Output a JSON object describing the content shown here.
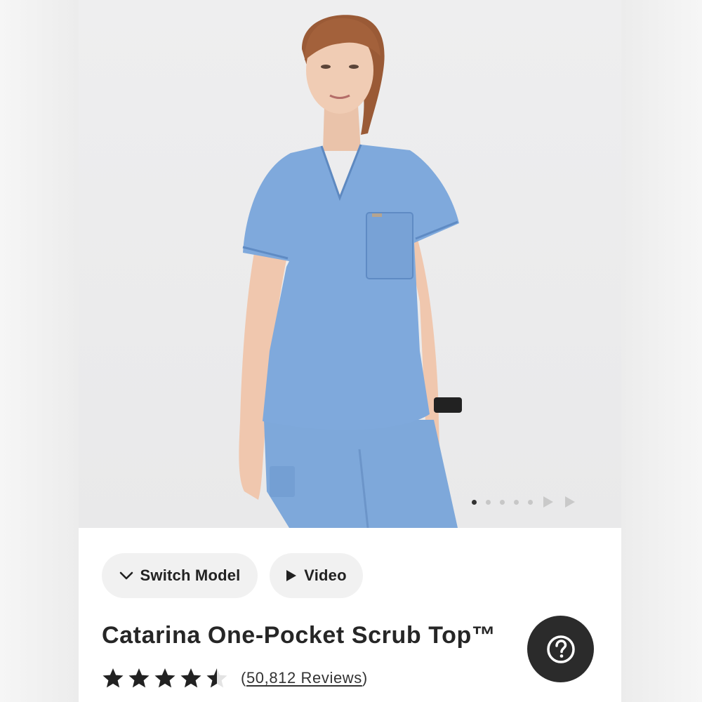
{
  "product": {
    "title": "Catarina One-Pocket Scrub Top™",
    "rating": 4.5,
    "rating_max": 5,
    "reviews_open": "(",
    "reviews_link": "50,812 Reviews",
    "reviews_close": ")"
  },
  "buttons": {
    "switch_model": "Switch Model",
    "video": "Video"
  },
  "carousel": {
    "slide_count": 5,
    "active_index": 0
  },
  "icons": {
    "switch_model": "chevron-down-icon",
    "video": "play-icon",
    "help": "question-mark-icon",
    "next": "triangle-right-icon"
  },
  "colors": {
    "scrub_blue": "#7fa9dc",
    "help_button": "#2b2b2b",
    "star": "#222222",
    "pill_bg": "#f1f1f1"
  }
}
